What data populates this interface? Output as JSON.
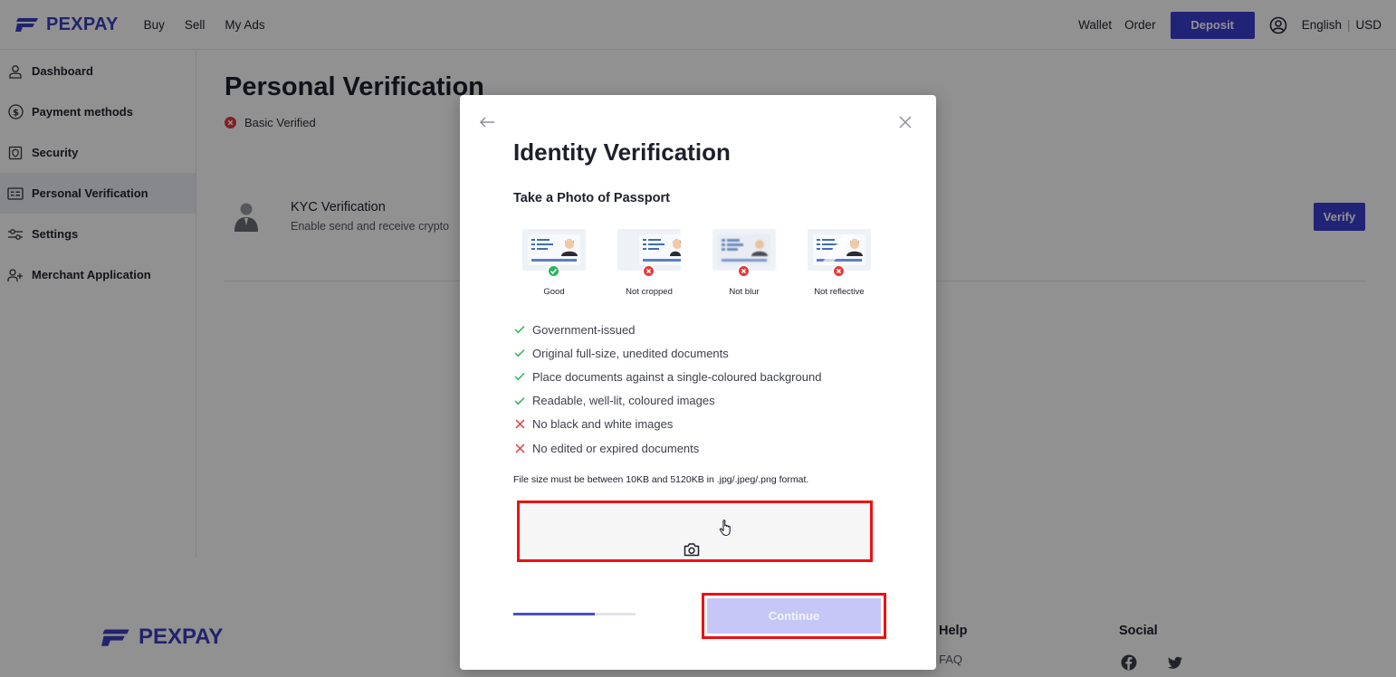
{
  "header": {
    "brand": "PEXPAY",
    "nav": [
      "Buy",
      "Sell",
      "My Ads"
    ],
    "links": [
      "Wallet",
      "Order"
    ],
    "deposit_label": "Deposit",
    "language": "English",
    "currency": "USD"
  },
  "sidebar": {
    "items": [
      {
        "label": "Dashboard",
        "icon": "user-icon"
      },
      {
        "label": "Payment methods",
        "icon": "dollar-circle-icon"
      },
      {
        "label": "Security",
        "icon": "shield-icon"
      },
      {
        "label": "Personal Verification",
        "icon": "id-card-icon",
        "active": true
      },
      {
        "label": "Settings",
        "icon": "sliders-icon"
      },
      {
        "label": "Merchant Application",
        "icon": "user-plus-icon"
      }
    ]
  },
  "main": {
    "title": "Personal Verification",
    "status": "Basic Verified",
    "kyc": {
      "title": "KYC Verification",
      "subtitle": "Enable send and receive crypto",
      "verify_label": "Verify"
    }
  },
  "footer": {
    "brand": "PEXPAY",
    "help_title": "Help",
    "help_links": [
      "FAQ"
    ],
    "social_title": "Social",
    "social_icons": [
      "facebook-icon",
      "twitter-icon"
    ]
  },
  "modal": {
    "title": "Identity Verification",
    "subtitle": "Take a Photo of Passport",
    "examples": [
      {
        "label": "Good",
        "status": "ok"
      },
      {
        "label": "Not cropped",
        "status": "bad"
      },
      {
        "label": "Not blur",
        "status": "bad"
      },
      {
        "label": "Not reflective",
        "status": "bad"
      }
    ],
    "rules": [
      {
        "text": "Government-issued",
        "ok": true
      },
      {
        "text": "Original full-size, unedited documents",
        "ok": true
      },
      {
        "text": "Place documents against a single-coloured background",
        "ok": true
      },
      {
        "text": "Readable, well-lit, coloured images",
        "ok": true
      },
      {
        "text": "No black and white images",
        "ok": false
      },
      {
        "text": "No edited or expired documents",
        "ok": false
      }
    ],
    "file_note": "File size must be between 10KB and 5120KB in .jpg/.jpeg/.png format.",
    "progress": 0.67,
    "continue_label": "Continue"
  },
  "colors": {
    "brand": "#3a3fc0",
    "primary": "#3b3fd1",
    "success": "#27b65a",
    "error": "#e23b3b",
    "continue_disabled": "#c6c7f7",
    "highlight": "#ee1111"
  }
}
